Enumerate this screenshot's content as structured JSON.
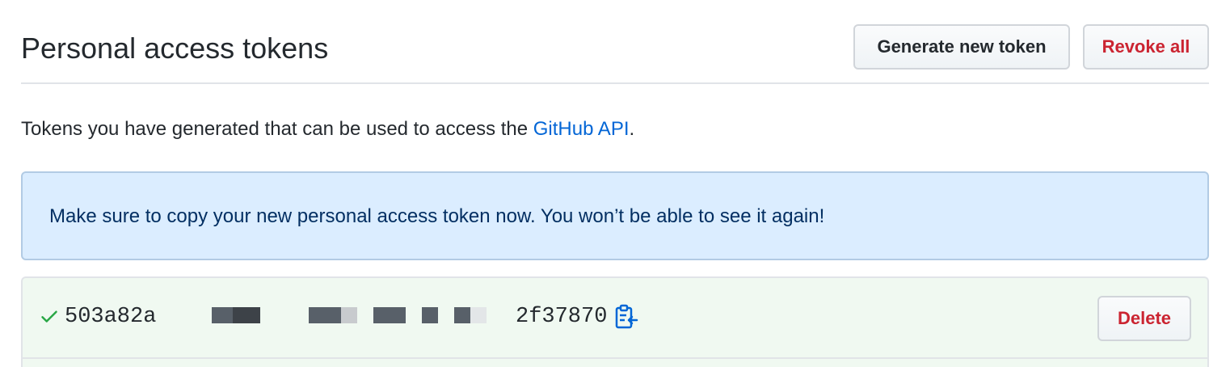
{
  "header": {
    "title": "Personal access tokens",
    "generate_label": "Generate new token",
    "revoke_label": "Revoke all"
  },
  "description": {
    "text": "Tokens you have generated that can be used to access the ",
    "link_text": "GitHub API",
    "suffix": "."
  },
  "flash": {
    "message": "Make sure to copy your new personal access token now. You won’t be able to see it again!"
  },
  "token": {
    "visible_prefix": "503a82a",
    "visible_suffix": "2f37870",
    "status_icon": "check-icon",
    "copy_icon": "clipboard-icon",
    "delete_label": "Delete"
  },
  "colors": {
    "link": "#0366d6",
    "danger": "#cb2431",
    "flash_bg": "#dbedff",
    "success_bg": "#f0f9f1",
    "success_icon": "#28a745"
  }
}
